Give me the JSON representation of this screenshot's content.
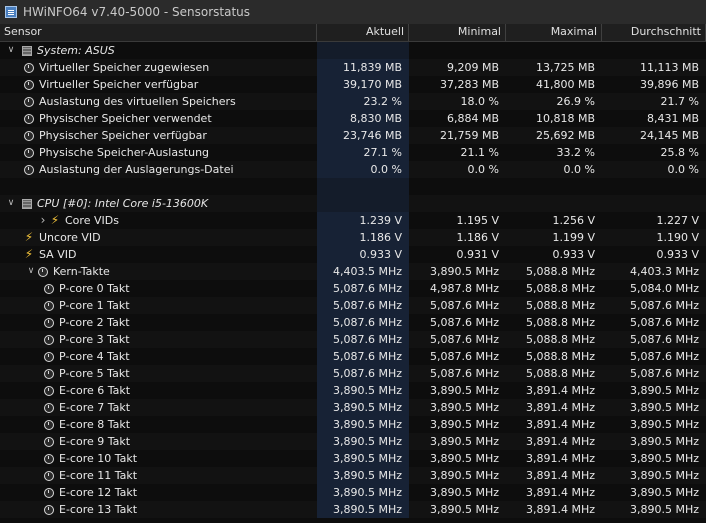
{
  "window": {
    "title": "HWiNFO64 v7.40-5000 - Sensorstatus"
  },
  "columns": {
    "sensor": "Sensor",
    "current": "Aktuell",
    "min": "Minimal",
    "max": "Maximal",
    "avg": "Durchschnitt"
  },
  "rows": [
    {
      "kind": "group",
      "label": "System: ASUS"
    },
    {
      "kind": "clock",
      "label": "Virtueller Speicher zugewiesen",
      "cur": "11,839 MB",
      "min": "9,209 MB",
      "max": "13,725 MB",
      "avg": "11,113 MB"
    },
    {
      "kind": "clock",
      "label": "Virtueller Speicher verfügbar",
      "cur": "39,170 MB",
      "min": "37,283 MB",
      "max": "41,800 MB",
      "avg": "39,896 MB"
    },
    {
      "kind": "clock",
      "label": "Auslastung des virtuellen Speichers",
      "cur": "23.2 %",
      "min": "18.0 %",
      "max": "26.9 %",
      "avg": "21.7 %"
    },
    {
      "kind": "clock",
      "label": "Physischer Speicher verwendet",
      "cur": "8,830 MB",
      "min": "6,884 MB",
      "max": "10,818 MB",
      "avg": "8,431 MB"
    },
    {
      "kind": "clock",
      "label": "Physischer Speicher verfügbar",
      "cur": "23,746 MB",
      "min": "21,759 MB",
      "max": "25,692 MB",
      "avg": "24,145 MB"
    },
    {
      "kind": "clock",
      "label": "Physische Speicher-Auslastung",
      "cur": "27.1 %",
      "min": "21.1 %",
      "max": "33.2 %",
      "avg": "25.8 %"
    },
    {
      "kind": "clock",
      "label": "Auslastung der Auslagerungs-Datei",
      "cur": "0.0 %",
      "min": "0.0 %",
      "max": "0.0 %",
      "avg": "0.0 %"
    },
    {
      "kind": "blank"
    },
    {
      "kind": "group",
      "label": "CPU [#0]: Intel Core i5-13600K"
    },
    {
      "kind": "bolt-expand",
      "label": "Core VIDs",
      "cur": "1.239 V",
      "min": "1.195 V",
      "max": "1.256 V",
      "avg": "1.227 V"
    },
    {
      "kind": "bolt",
      "label": "Uncore VID",
      "cur": "1.186 V",
      "min": "1.186 V",
      "max": "1.199 V",
      "avg": "1.190 V"
    },
    {
      "kind": "bolt",
      "label": "SA VID",
      "cur": "0.933 V",
      "min": "0.931 V",
      "max": "0.933 V",
      "avg": "0.933 V"
    },
    {
      "kind": "clock-expanded",
      "label": "Kern-Takte",
      "cur": "4,403.5 MHz",
      "min": "3,890.5 MHz",
      "max": "5,088.8 MHz",
      "avg": "4,403.3 MHz"
    },
    {
      "kind": "sub",
      "label": "P-core 0 Takt",
      "cur": "5,087.6 MHz",
      "min": "4,987.8 MHz",
      "max": "5,088.8 MHz",
      "avg": "5,084.0 MHz"
    },
    {
      "kind": "sub",
      "label": "P-core 1 Takt",
      "cur": "5,087.6 MHz",
      "min": "5,087.6 MHz",
      "max": "5,088.8 MHz",
      "avg": "5,087.6 MHz"
    },
    {
      "kind": "sub",
      "label": "P-core 2 Takt",
      "cur": "5,087.6 MHz",
      "min": "5,087.6 MHz",
      "max": "5,088.8 MHz",
      "avg": "5,087.6 MHz"
    },
    {
      "kind": "sub",
      "label": "P-core 3 Takt",
      "cur": "5,087.6 MHz",
      "min": "5,087.6 MHz",
      "max": "5,088.8 MHz",
      "avg": "5,087.6 MHz"
    },
    {
      "kind": "sub",
      "label": "P-core 4 Takt",
      "cur": "5,087.6 MHz",
      "min": "5,087.6 MHz",
      "max": "5,088.8 MHz",
      "avg": "5,087.6 MHz"
    },
    {
      "kind": "sub",
      "label": "P-core 5 Takt",
      "cur": "5,087.6 MHz",
      "min": "5,087.6 MHz",
      "max": "5,088.8 MHz",
      "avg": "5,087.6 MHz"
    },
    {
      "kind": "sub",
      "label": "E-core 6 Takt",
      "cur": "3,890.5 MHz",
      "min": "3,890.5 MHz",
      "max": "3,891.4 MHz",
      "avg": "3,890.5 MHz"
    },
    {
      "kind": "sub",
      "label": "E-core 7 Takt",
      "cur": "3,890.5 MHz",
      "min": "3,890.5 MHz",
      "max": "3,891.4 MHz",
      "avg": "3,890.5 MHz"
    },
    {
      "kind": "sub",
      "label": "E-core 8 Takt",
      "cur": "3,890.5 MHz",
      "min": "3,890.5 MHz",
      "max": "3,891.4 MHz",
      "avg": "3,890.5 MHz"
    },
    {
      "kind": "sub",
      "label": "E-core 9 Takt",
      "cur": "3,890.5 MHz",
      "min": "3,890.5 MHz",
      "max": "3,891.4 MHz",
      "avg": "3,890.5 MHz"
    },
    {
      "kind": "sub",
      "label": "E-core 10 Takt",
      "cur": "3,890.5 MHz",
      "min": "3,890.5 MHz",
      "max": "3,891.4 MHz",
      "avg": "3,890.5 MHz"
    },
    {
      "kind": "sub",
      "label": "E-core 11 Takt",
      "cur": "3,890.5 MHz",
      "min": "3,890.5 MHz",
      "max": "3,891.4 MHz",
      "avg": "3,890.5 MHz"
    },
    {
      "kind": "sub",
      "label": "E-core 12 Takt",
      "cur": "3,890.5 MHz",
      "min": "3,890.5 MHz",
      "max": "3,891.4 MHz",
      "avg": "3,890.5 MHz"
    },
    {
      "kind": "sub",
      "label": "E-core 13 Takt",
      "cur": "3,890.5 MHz",
      "min": "3,890.5 MHz",
      "max": "3,891.4 MHz",
      "avg": "3,890.5 MHz"
    }
  ]
}
